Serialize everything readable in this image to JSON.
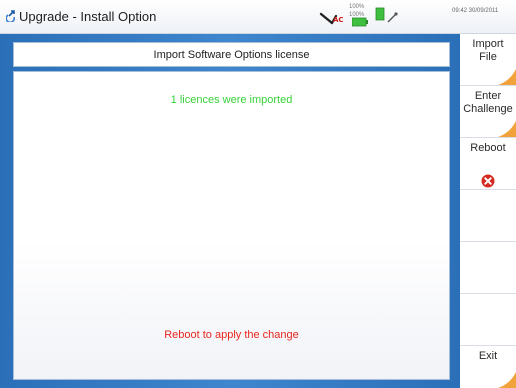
{
  "window": {
    "title": "Upgrade - Install Option",
    "status": {
      "battery_top": "100%",
      "battery_bottom": "100%",
      "clock": "09:42 30/09/2011"
    }
  },
  "dialog": {
    "title": "Import Software Options license",
    "success_message": "1 licences were imported",
    "reboot_message": "Reboot to apply the change"
  },
  "softkeys": [
    {
      "label_line1": "Import",
      "label_line2": "File"
    },
    {
      "label_line1": "Enter",
      "label_line2": "Challenge"
    },
    {
      "label_line1": "Reboot",
      "label_line2": ""
    },
    {
      "label_line1": "",
      "label_line2": ""
    },
    {
      "label_line1": "",
      "label_line2": ""
    },
    {
      "label_line1": "",
      "label_line2": ""
    },
    {
      "label_line1": "Exit",
      "label_line2": ""
    }
  ],
  "colors": {
    "frame_blue": "#3f86cf",
    "success_green": "#38d13a",
    "reboot_red": "#e8251e",
    "accent_orange": "#f2a23a"
  }
}
